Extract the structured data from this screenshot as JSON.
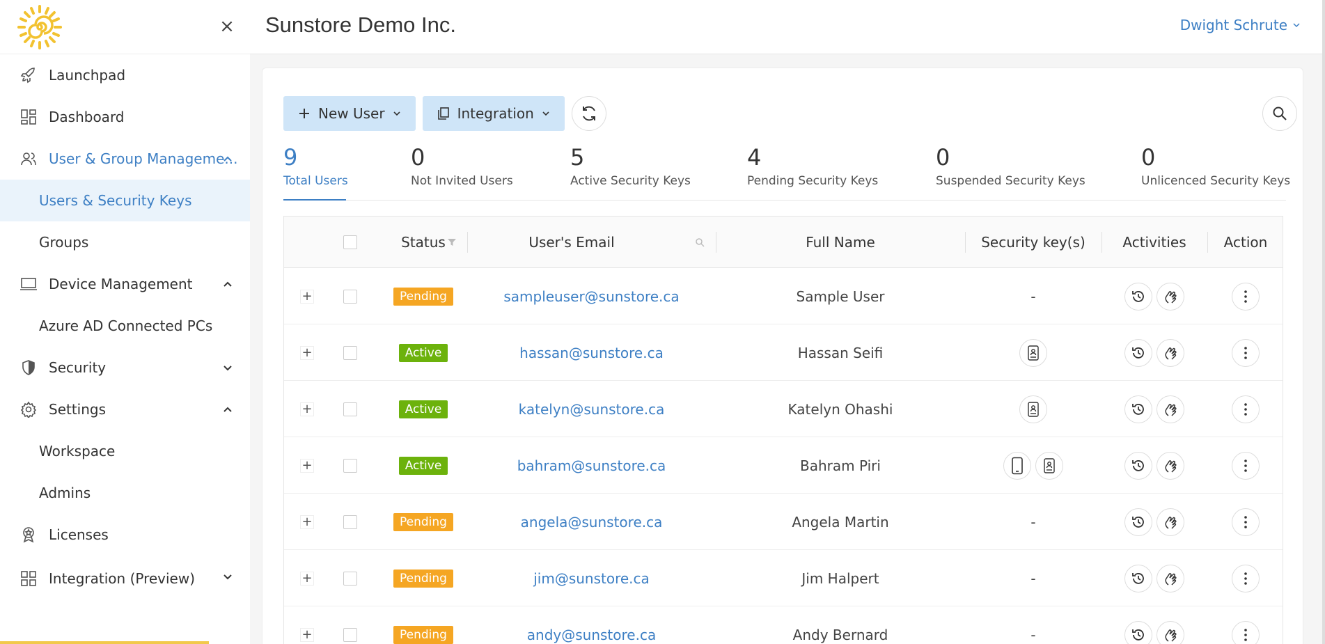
{
  "header": {
    "org_name": "Sunstore Demo Inc.",
    "user_name": "Dwight Schrute"
  },
  "sidebar": {
    "items": [
      {
        "label": "Launchpad",
        "icon": "rocket-icon"
      },
      {
        "label": "Dashboard",
        "icon": "dashboard-icon"
      },
      {
        "label": "User & Group Manageme...",
        "icon": "users-icon",
        "expanded": true
      },
      {
        "label": "Users & Security Keys",
        "sub": true,
        "selected": true
      },
      {
        "label": "Groups",
        "sub": true
      },
      {
        "label": "Device Management",
        "icon": "laptop-icon",
        "expanded": true
      },
      {
        "label": "Azure AD Connected PCs",
        "sub": true
      },
      {
        "label": "Security",
        "icon": "shield-icon",
        "expanded": false
      },
      {
        "label": "Settings",
        "icon": "gear-icon",
        "expanded": true
      },
      {
        "label": "Workspace",
        "sub": true
      },
      {
        "label": "Admins",
        "sub": true
      },
      {
        "label": "Licenses",
        "icon": "license-icon"
      },
      {
        "label": "Integration (Preview)",
        "icon": "grid-icon",
        "expanded": false
      }
    ]
  },
  "toolbar": {
    "new_user": "New User",
    "integration": "Integration"
  },
  "stats": [
    {
      "num": "9",
      "label": "Total Users",
      "active": true
    },
    {
      "num": "0",
      "label": "Not Invited Users"
    },
    {
      "num": "5",
      "label": "Active Security Keys"
    },
    {
      "num": "4",
      "label": "Pending Security Keys"
    },
    {
      "num": "0",
      "label": "Suspended Security Keys"
    },
    {
      "num": "0",
      "label": "Unlicenced Security Keys"
    }
  ],
  "table": {
    "headers": {
      "status": "Status",
      "email": "User's Email",
      "full_name": "Full Name",
      "keys": "Security key(s)",
      "activities": "Activities",
      "action": "Action"
    },
    "rows": [
      {
        "status": "Pending",
        "email": "sampleuser@sunstore.ca",
        "name": "Sample User",
        "keys": []
      },
      {
        "status": "Active",
        "email": "hassan@sunstore.ca",
        "name": "Hassan Seifi",
        "keys": [
          "card"
        ]
      },
      {
        "status": "Active",
        "email": "katelyn@sunstore.ca",
        "name": "Katelyn Ohashi",
        "keys": [
          "card"
        ]
      },
      {
        "status": "Active",
        "email": "bahram@sunstore.ca",
        "name": "Bahram Piri",
        "keys": [
          "phone",
          "card"
        ]
      },
      {
        "status": "Pending",
        "email": "angela@sunstore.ca",
        "name": "Angela Martin",
        "keys": []
      },
      {
        "status": "Pending",
        "email": "jim@sunstore.ca",
        "name": "Jim Halpert",
        "keys": []
      },
      {
        "status": "Pending",
        "email": "andy@sunstore.ca",
        "name": "Andy Bernard",
        "keys": []
      }
    ],
    "no_keys": "-"
  },
  "colors": {
    "accent": "#3d7fc4",
    "pending": "#f5a623",
    "active": "#6cb20c",
    "button_bg": "#cfe5f8"
  }
}
